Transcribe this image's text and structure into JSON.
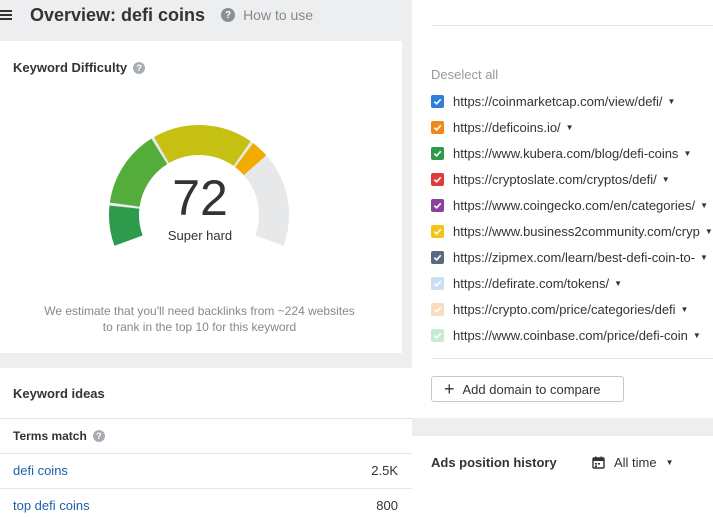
{
  "header": {
    "title": "Overview: defi coins",
    "how_to_label": "How to use"
  },
  "keyword_difficulty": {
    "title": "Keyword Difficulty",
    "value": "72",
    "label": "Super hard",
    "note_line1": "We estimate that you'll need backlinks from ~224 websites",
    "note_line2": "to rank in the top 10 for this keyword",
    "score_max": 100
  },
  "keyword_ideas": {
    "title": "Keyword ideas",
    "terms_title": "Terms match",
    "rows": [
      {
        "keyword": "defi coins",
        "volume": "2.5K"
      },
      {
        "keyword": "top defi coins",
        "volume": "800"
      }
    ]
  },
  "compare": {
    "deselect_label": "Deselect all",
    "urls": [
      {
        "url": "https://coinmarketcap.com/view/defi/",
        "color": "#2f7fd8"
      },
      {
        "url": "https://deficoins.io/",
        "color": "#f0891b"
      },
      {
        "url": "https://www.kubera.com/blog/defi-coins",
        "color": "#2e9a4c"
      },
      {
        "url": "https://cryptoslate.com/cryptos/defi/",
        "color": "#e03b3b"
      },
      {
        "url": "https://www.coingecko.com/en/categories/",
        "color": "#8b3f9e"
      },
      {
        "url": "https://www.business2community.com/cryp",
        "color": "#f2c418"
      },
      {
        "url": "https://zipmex.com/learn/best-defi-coin-to-",
        "color": "#5a6b7e"
      },
      {
        "url": "https://defirate.com/tokens/",
        "color": "#c8dff5"
      },
      {
        "url": "https://crypto.com/price/categories/defi",
        "color": "#f7dcc0"
      },
      {
        "url": "https://www.coinbase.com/price/defi-coin",
        "color": "#c5ecd3"
      }
    ],
    "add_label": "Add domain to compare"
  },
  "ads_history": {
    "title": "Ads position history",
    "range_label": "All time"
  },
  "icons": {
    "menu": "menu-icon",
    "help": "help-icon",
    "checkbox": "checkmark-icon",
    "dropdown": "chevron-down-icon",
    "add": "plus-icon",
    "calendar": "calendar-icon"
  },
  "colors": {
    "gauge_green": "#2e9a4c",
    "gauge_yellow": "#c6c012",
    "gauge_orange": "#f2ab00",
    "gauge_empty": "#e7e8ea",
    "link": "#1f5fa8"
  }
}
